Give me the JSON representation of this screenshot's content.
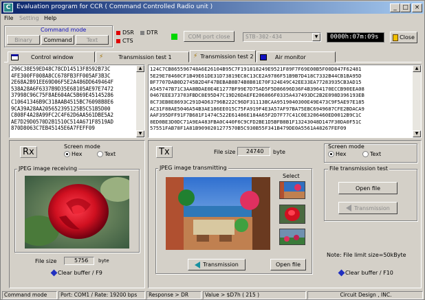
{
  "window": {
    "title": "Evaluation program for CCR ( Command Controlled Radio unit )",
    "app_icon_letter": "C",
    "min_label": "_",
    "max_label": "□",
    "close_label": "×"
  },
  "menu": {
    "file": "File",
    "setting": "Setting",
    "help": "Help"
  },
  "mode_group": {
    "title": "Command mode",
    "buttons": [
      "Binary",
      "Command",
      "Text"
    ]
  },
  "indicators": {
    "dsr": "DSR",
    "dtr": "DTR",
    "cts": "CTS",
    "colors": {
      "dsr": "#e00000",
      "dtr": "#808080",
      "cts": "#e00000",
      "port_led": "#00d800"
    }
  },
  "port": {
    "close_button": "COM port close",
    "setting_value": "STB-302-434",
    "timer": "0000h:07m:09s",
    "app_close": "Close"
  },
  "tabs": [
    {
      "label": "Control window",
      "icon": "window-icon"
    },
    {
      "label": "Transmission test 1",
      "icon": "antenna-icon"
    },
    {
      "label": "Transmission test 2",
      "icon": "antenna-icon"
    },
    {
      "label": "Air monitor",
      "icon": "monitor-icon"
    }
  ],
  "rx_hex": "296C38E59ED48C78CD14513F8592B73C\n4FE300FF008A8CC678FB3FF005AF3B3C\n2E68A2B91EE69D06F5E2A486DD649464F\n538A28A6F6337B9D35E68105AE97E7472\n37998C96C75F8AE604AC5B69E45145286\nC10641346B9C318AAB4515BC76098B8E6\n9CA39A28AA205652395125B5C51B5D00\nC808F4A28A99FC2C4F62D6AA561DBE5A2\nAE7D29D0570D2B1510C514A671F8519AD\n870D8063C7EB45145E6A7FEFF09",
  "tx_hex": "124C7CB865596748A6E26104B95C7F191818249E9521F89F7F69E00B5F00D847F62481\n5E29E78460CF1B49E61DE31D73819EC8C13CE2A9786F51B9B7D418C7332B44CB1BA95D\nBF7707DAB0D2745B2D4F47BEBAB8B74B8B81E70F324E49C42EE33EA77283935CB3AD15\nA545747B71C3AA8BDAE0E4E1277BF99E7D75AD5F5D86696D36F4B3964170ECCB90EEA08\n0467EEE373703FBDC8E95D47C19D26DAEFE206866F0335A437493DC2B2E098D396193EB\n8C73EB8E8693C291D4D63796B222C96DF31113BCAA9519040300E49E473C9F5AE97E185\nAC31F88AE5046A54B3AE186EE015C75FA919F4E3A57AF97BA75EBC6949687CFE2BDACA9\nAAF395DFF91F7B681F1474C522E61486E184A65F2D7F77C41C0E3206460ED0012B9C1C\n8ED0BE3D0DC71A9EA483FBA0C440F6C9CFD2BE1D5BFB8B1F13243048D147F30DA0F51C\n57551FAB78F1A81B9090201277570B5C930B55F341B479DE0A5561A48267FEF09",
  "rx": {
    "label": "Rx",
    "screen_mode_title": "Screen mode",
    "hex": "Hex",
    "text": "Text",
    "group_title": "JPEG image receiving",
    "file_size_label": "File size",
    "file_size": "5756",
    "unit": "byte",
    "clear": "Clear buffer / F9"
  },
  "tx": {
    "label": "Tx",
    "file_size_label": "File size",
    "file_size": "24740",
    "unit": "byte",
    "group_title": "JPEG image transmitting",
    "select_label": "Select",
    "transmission_button": "Transmission",
    "open_file_button": "Open file"
  },
  "right_panel": {
    "screen_mode_title": "Screen mode",
    "hex": "Hex",
    "text": "Text",
    "group_title": "File transmission test",
    "open_file": "Open file",
    "transmission": "Transmission",
    "note": "Note: File limit size=50kByte",
    "clear": "Clear buffer / F10"
  },
  "status": {
    "mode": "Command mode",
    "port": "Port: COM1 / Rate: 19200 bps",
    "response": "Response > DR",
    "value": "Value > $D7h ( 215 )",
    "company": "Circuit Design , INC."
  }
}
